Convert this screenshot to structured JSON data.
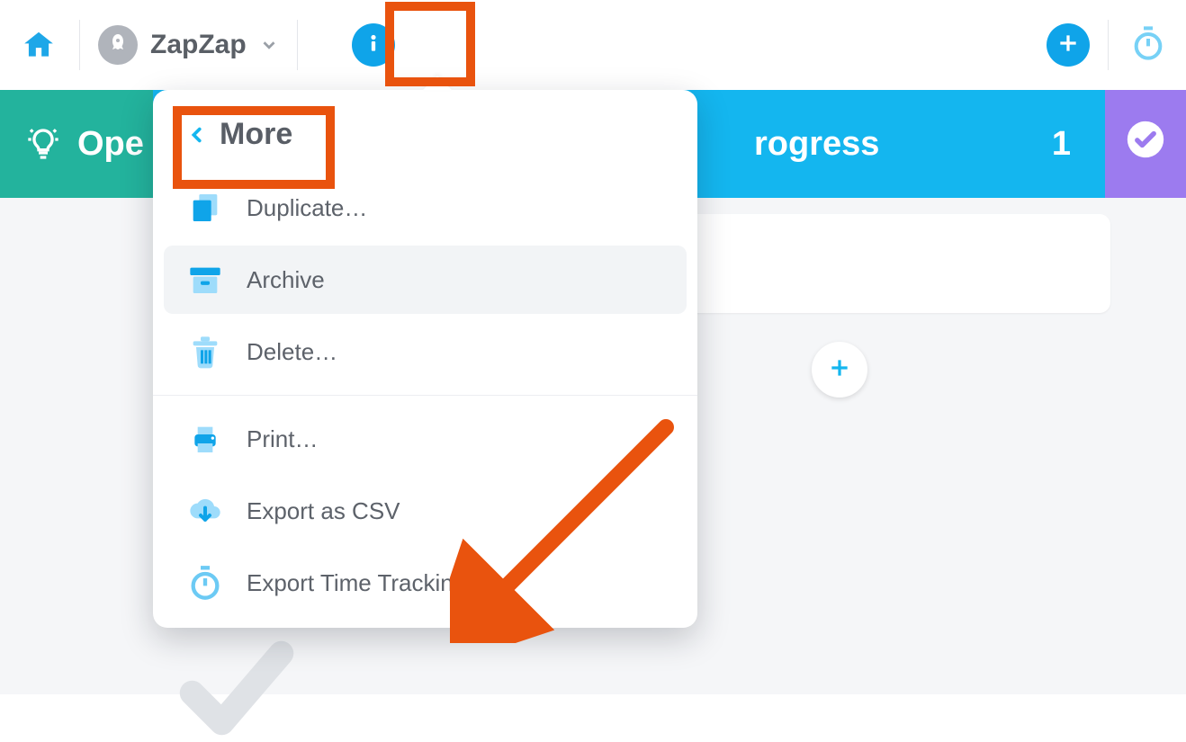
{
  "topbar": {
    "project_name": "ZapZap"
  },
  "columns": {
    "open": {
      "label": "Ope"
    },
    "in_progress": {
      "label": "rogress",
      "count": "1"
    }
  },
  "popover": {
    "header": "More",
    "items": [
      {
        "label": "Duplicate…"
      },
      {
        "label": "Archive"
      },
      {
        "label": "Delete…"
      },
      {
        "label": "Print…"
      },
      {
        "label": "Export as CSV"
      },
      {
        "label": "Export Time Tracking"
      }
    ]
  }
}
